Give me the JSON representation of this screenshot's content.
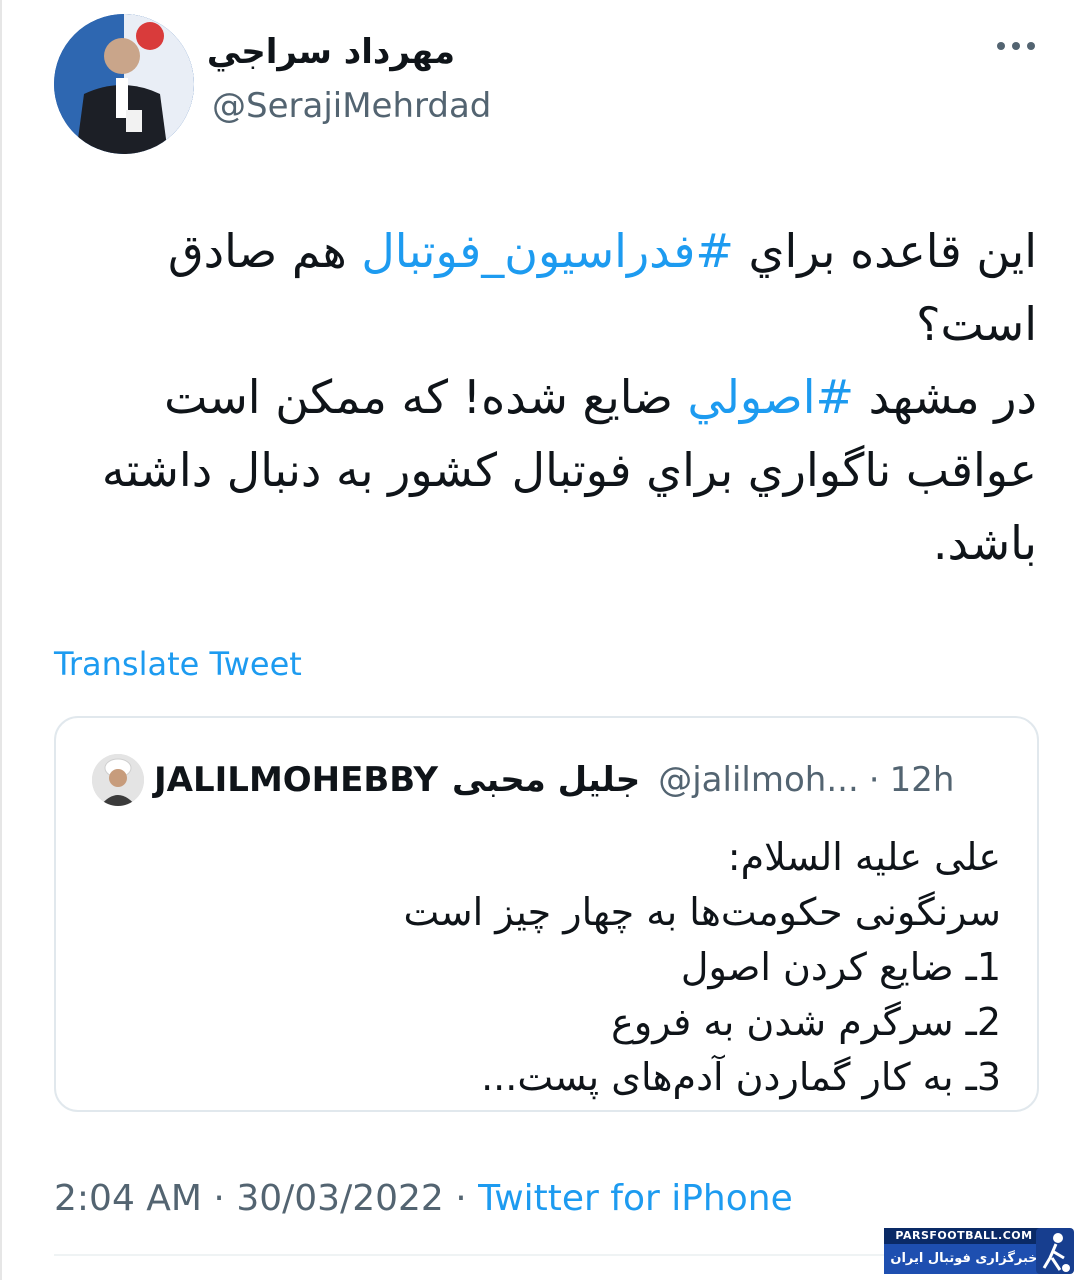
{
  "author": {
    "name": "مهرداد سراجي",
    "handle": "@SerajiMehrdad"
  },
  "tweet": {
    "line1_pre": "اين قاعده براي ",
    "hashtag1": "#فدراسيون_فوتبال",
    "line1_post": " هم صادق است؟",
    "line2_pre": "در مشهد ",
    "hashtag2": "#اصولي",
    "line2_post": " ضايع شده! كه ممكن است عواقب ناگواري براي فوتبال كشور به دنبال داشته باشد."
  },
  "translate_label": "Translate Tweet",
  "quoted": {
    "name_en": "JALILMOHEBBY",
    "name_fa": "جلیل محبی",
    "handle": "@jalilmoh...",
    "separator": "·",
    "time": "12h",
    "lines": [
      "علی علیه السلام:",
      "سرنگونی حکومت‌ها به چهار چیز است",
      "1ـ ضایع کردن اصول",
      "2ـ سرگرم شدن به فروع",
      "3ـ به کار گماردن آدم‌های پست..."
    ]
  },
  "footer": {
    "time": "2:04 AM",
    "sep1": " · ",
    "date": "30/03/2022",
    "sep2": " · ",
    "source": "Twitter for iPhone"
  },
  "watermark": {
    "site": "PARSFOOTBALL.COM",
    "label": "خبرگزاری فوتبال ایران"
  },
  "icons": {
    "more": "more-horizontal-icon"
  }
}
